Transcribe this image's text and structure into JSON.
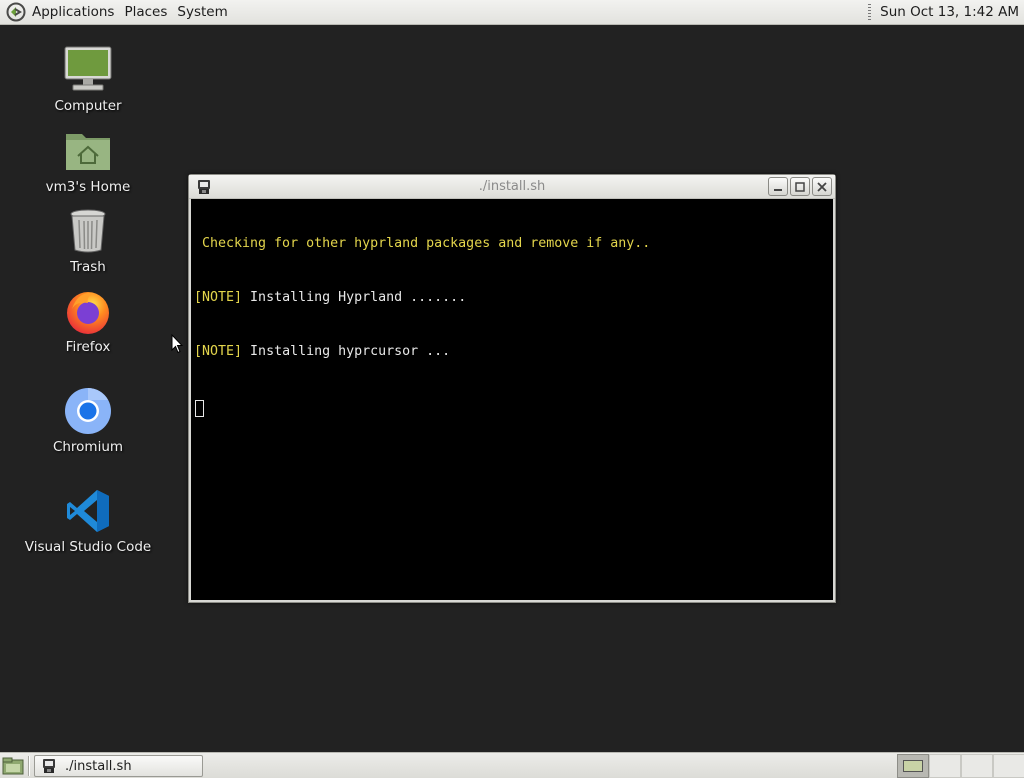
{
  "top_panel": {
    "menus": [
      "Applications",
      "Places",
      "System"
    ],
    "clock": "Sun Oct 13,  1:42 AM"
  },
  "desktop_icons": [
    {
      "label": "Computer",
      "icon": "computer-icon"
    },
    {
      "label": "vm3's Home",
      "icon": "home-folder-icon"
    },
    {
      "label": "Trash",
      "icon": "trash-icon"
    },
    {
      "label": "Firefox",
      "icon": "firefox-icon"
    },
    {
      "label": "Chromium",
      "icon": "chromium-icon"
    },
    {
      "label": "Visual Studio Code",
      "icon": "vscode-icon"
    }
  ],
  "terminal": {
    "title": "./install.sh",
    "lines": [
      {
        "prefix": "",
        "text": " Checking for other hyprland packages and remove if any..",
        "color": "yellow"
      },
      {
        "prefix": "[NOTE]",
        "text": " Installing Hyprland .......",
        "color": "white"
      },
      {
        "prefix": "[NOTE]",
        "text": " Installing hyprcursor ...",
        "color": "white"
      }
    ]
  },
  "taskbar": {
    "task_label": "./install.sh",
    "workspace_count": 4,
    "active_workspace": 1
  },
  "colors": {
    "desktop_bg": "#222222",
    "terminal_bg": "#000000",
    "terminal_yellow": "#e3d54c",
    "terminal_text": "#e8e8e8"
  }
}
